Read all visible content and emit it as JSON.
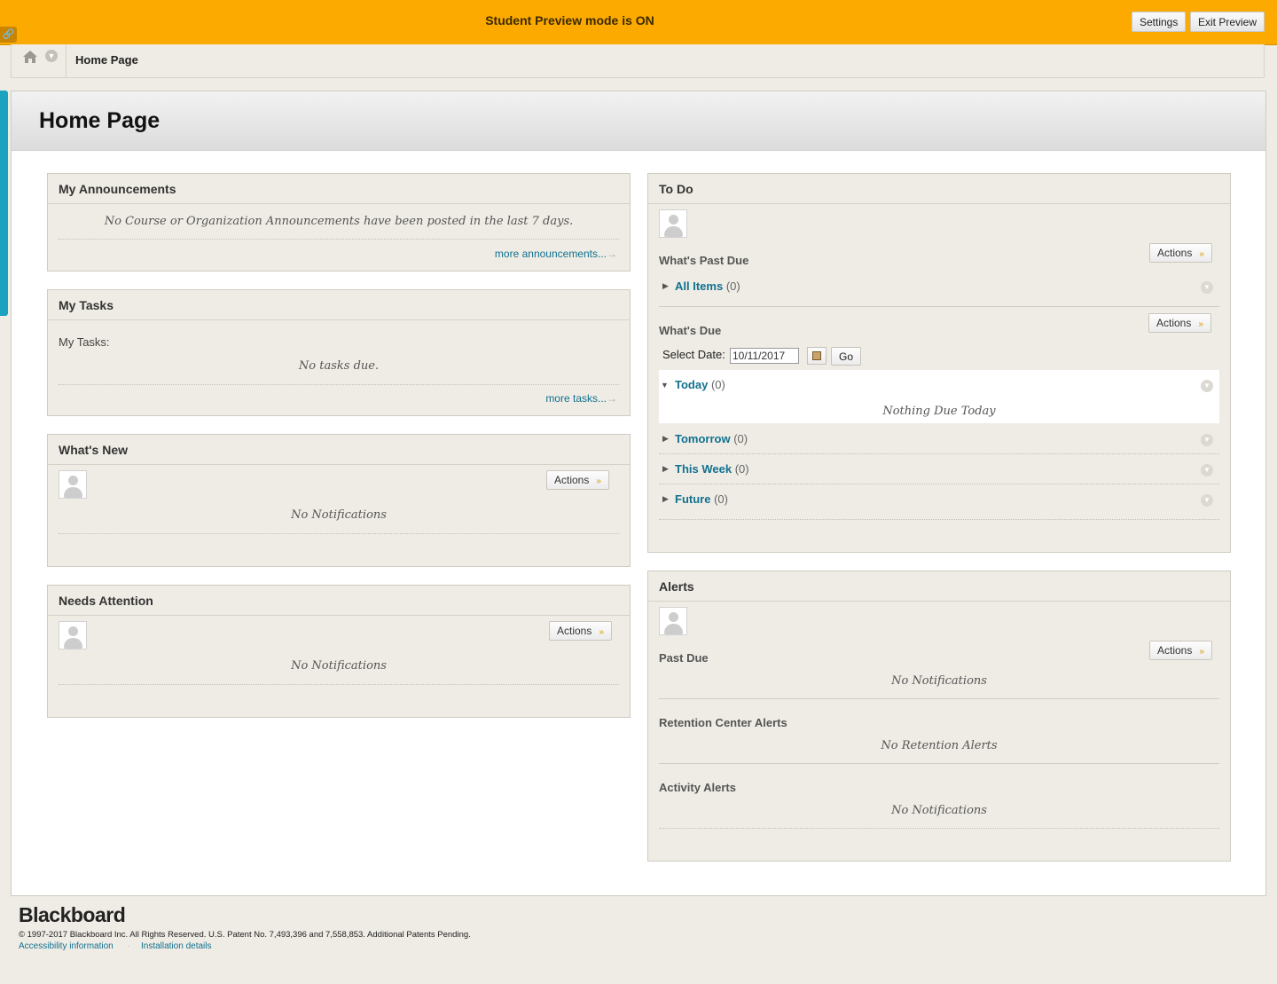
{
  "banner": {
    "title": "Student Preview mode is ON",
    "settings_label": "Settings",
    "exit_label": "Exit Preview"
  },
  "breadcrumb": {
    "current": "Home Page"
  },
  "page": {
    "title": "Home Page"
  },
  "announcements": {
    "title": "My Announcements",
    "empty": "No Course or Organization Announcements have been posted in the last 7 days.",
    "more": "more announcements..."
  },
  "tasks": {
    "title": "My Tasks",
    "label": "My Tasks:",
    "empty": "No tasks due.",
    "more": "more tasks..."
  },
  "whats_new": {
    "title": "What's New",
    "actions": "Actions",
    "empty": "No Notifications"
  },
  "needs_attention": {
    "title": "Needs Attention",
    "actions": "Actions",
    "empty": "No Notifications"
  },
  "todo": {
    "title": "To Do",
    "past_due_title": "What's Past Due",
    "past_due_actions": "Actions",
    "all_items_label": "All Items",
    "all_items_count": "(0)",
    "due_title": "What's Due",
    "due_actions": "Actions",
    "select_date_label": "Select Date:",
    "date_value": "10/11/2017",
    "go_label": "Go",
    "today_label": "Today",
    "today_count": "(0)",
    "today_empty": "Nothing Due Today",
    "tomorrow_label": "Tomorrow",
    "tomorrow_count": "(0)",
    "week_label": "This Week",
    "week_count": "(0)",
    "future_label": "Future",
    "future_count": "(0)"
  },
  "alerts": {
    "title": "Alerts",
    "past_due_title": "Past Due",
    "actions": "Actions",
    "past_due_empty": "No Notifications",
    "retention_title": "Retention Center Alerts",
    "retention_empty": "No Retention Alerts",
    "activity_title": "Activity Alerts",
    "activity_empty": "No Notifications"
  },
  "footer": {
    "logo": "Blackboard",
    "copyright": "© 1997-2017 Blackboard Inc. All Rights Reserved. U.S. Patent No. 7,493,396 and 7,558,853. Additional Patents Pending.",
    "accessibility": "Accessibility information",
    "installation": "Installation details"
  },
  "colors": {
    "banner": "#fca900",
    "link": "#11718f",
    "accent": "#1aa2be",
    "module_bg": "#efece5"
  },
  "icons": [
    "link-icon",
    "home-icon",
    "chevron-down-icon",
    "calendar-icon",
    "avatar-icon"
  ]
}
